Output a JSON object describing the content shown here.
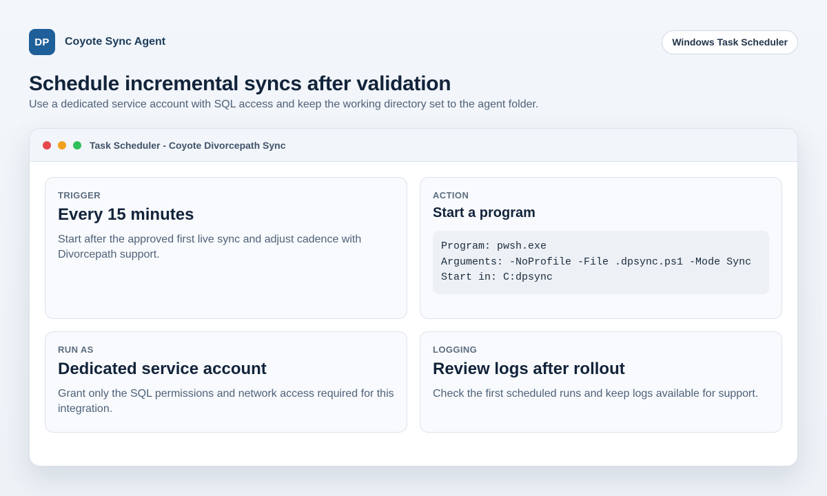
{
  "header": {
    "logo_text": "DP",
    "app_name": "Coyote Sync Agent",
    "pill_label": "Windows Task Scheduler"
  },
  "hero": {
    "title": "Schedule incremental syncs after validation",
    "subtitle": "Use a dedicated service account with SQL access and keep the working directory set to the agent folder."
  },
  "window": {
    "title": "Task Scheduler - Coyote Divorcepath Sync"
  },
  "cards": {
    "trigger": {
      "label": "TRIGGER",
      "title": "Every 15 minutes",
      "description": "Start after the approved first live sync and adjust cadence with Divorcepath support."
    },
    "action": {
      "label": "ACTION",
      "title": "Start a program",
      "program": "Program: pwsh.exe",
      "arguments": "Arguments: -NoProfile -File .dpsync.ps1 -Mode Sync",
      "start_in": "Start in: C:dpsync"
    },
    "run_as": {
      "label": "RUN AS",
      "title": "Dedicated service account",
      "description": "Grant only the SQL permissions and network access required for this integration."
    },
    "logging": {
      "label": "LOGGING",
      "title": "Review logs after rollout",
      "description": "Check the first scheduled runs and keep logs available for support."
    }
  },
  "colors": {
    "accent": "#1f5f99",
    "dot_red": "#e5484d",
    "dot_amber": "#f0a01c",
    "dot_green": "#2fbf5b"
  }
}
